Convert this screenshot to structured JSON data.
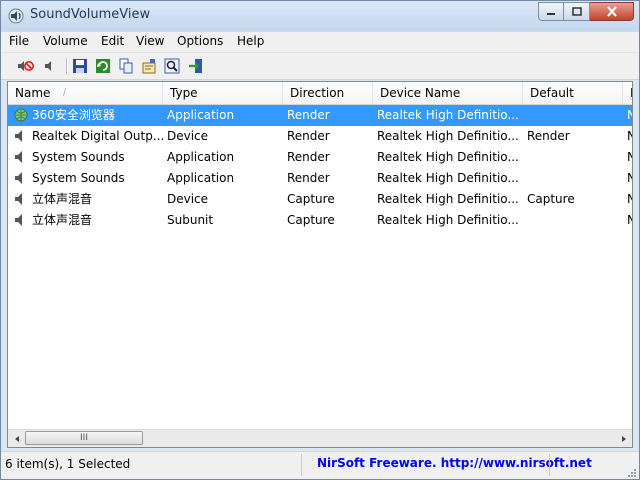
{
  "window": {
    "title": "SoundVolumeView"
  },
  "menu": [
    "File",
    "Volume",
    "Edit",
    "View",
    "Options",
    "Help"
  ],
  "toolbar": [
    {
      "name": "mute-icon"
    },
    {
      "name": "unmute-icon"
    },
    {
      "name": "save-icon"
    },
    {
      "name": "refresh-icon"
    },
    {
      "name": "copy-icon"
    },
    {
      "name": "properties-icon"
    },
    {
      "name": "find-icon"
    },
    {
      "name": "exit-icon"
    }
  ],
  "table": {
    "columns": [
      "Name",
      "Type",
      "Direction",
      "Device Name",
      "Default",
      "M"
    ],
    "rows": [
      {
        "name": "360安全浏览器",
        "type": "Application",
        "direction": "Render",
        "device": "Realtek High Definitio...",
        "default": "",
        "extra": "N",
        "icon": "browser-icon",
        "selected": true
      },
      {
        "name": "Realtek Digital Outp...",
        "type": "Device",
        "direction": "Render",
        "device": "Realtek High Definitio...",
        "default": "Render",
        "extra": "N",
        "icon": "speaker-icon",
        "selected": false
      },
      {
        "name": "System Sounds",
        "type": "Application",
        "direction": "Render",
        "device": "Realtek High Definitio...",
        "default": "",
        "extra": "N",
        "icon": "speaker-icon",
        "selected": false
      },
      {
        "name": "System Sounds",
        "type": "Application",
        "direction": "Render",
        "device": "Realtek High Definitio...",
        "default": "",
        "extra": "N",
        "icon": "speaker-icon",
        "selected": false
      },
      {
        "name": "立体声混音",
        "type": "Device",
        "direction": "Capture",
        "device": "Realtek High Definitio...",
        "default": "Capture",
        "extra": "N",
        "icon": "speaker-icon",
        "selected": false
      },
      {
        "name": "立体声混音",
        "type": "Subunit",
        "direction": "Capture",
        "device": "Realtek High Definitio...",
        "default": "",
        "extra": "N",
        "icon": "speaker-icon",
        "selected": false
      }
    ]
  },
  "scrollbar": {
    "thumb_glyph": "III"
  },
  "status": {
    "items": "6 item(s), 1 Selected",
    "link": "NirSoft Freeware.  http://www.nirsoft.net"
  },
  "colors": {
    "selection": "#3399ff",
    "link": "#0000ff",
    "close_button": "#c5422c"
  }
}
